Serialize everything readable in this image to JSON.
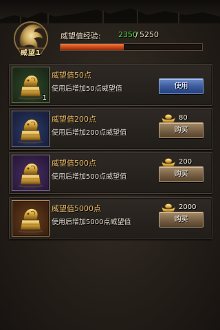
{
  "header": {
    "emblem_level": "1",
    "emblem_label": "威望1",
    "exp_label": "威望值经验:",
    "exp_current": "2350",
    "exp_separator": "/",
    "exp_max": "5250",
    "exp_progress_fraction": 0.448
  },
  "items": [
    {
      "name": "威望值50点",
      "desc": "使用后增加50点威望值",
      "count": "1",
      "frame_color": "green",
      "action": "使用",
      "price": ""
    },
    {
      "name": "威望值200点",
      "desc": "使用后增加200点威望值",
      "count": "",
      "frame_color": "blue",
      "action": "购买",
      "price": "80"
    },
    {
      "name": "威望值500点",
      "desc": "使用后增加500点威望值",
      "count": "",
      "frame_color": "purple",
      "action": "购买",
      "price": "200"
    },
    {
      "name": "威望值5000点",
      "desc": "使用后增加5000点威望值",
      "count": "",
      "frame_color": "orange",
      "action": "购买",
      "price": "2000"
    }
  ],
  "icons": {
    "emblem": "dragon-emblem-icon",
    "item": "gold-seal-icon",
    "currency": "gold-ingot-icon"
  },
  "colors": {
    "exp_current": "#4ad447",
    "item_name": "#e7b866",
    "use_button": "#3c5c9e",
    "buy_button": "#7a6246",
    "exp_fill": "#c24318"
  }
}
